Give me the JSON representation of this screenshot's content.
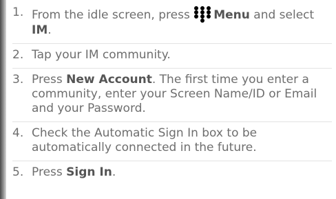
{
  "steps": [
    {
      "number": "1.",
      "parts": [
        "From the idle screen, press ",
        "Menu",
        " and select ",
        "IM",
        "."
      ]
    },
    {
      "number": "2.",
      "parts": [
        "Tap your IM community."
      ]
    },
    {
      "number": "3.",
      "parts": [
        "Press ",
        "New Account",
        ". The first time you enter a community, enter your Screen Name/ID or Email and your Password."
      ]
    },
    {
      "number": "4.",
      "parts": [
        "Check the Automatic Sign In box to be automatically connected in the future."
      ]
    },
    {
      "number": "5.",
      "parts": [
        "Press ",
        "Sign In",
        "."
      ]
    }
  ],
  "icons": {
    "menu": "menu-dots-icon"
  },
  "colors": {
    "text": "#6e6e6e",
    "emphasis": "#555555",
    "divider": "#e3e3e3",
    "icon": "#000000"
  }
}
